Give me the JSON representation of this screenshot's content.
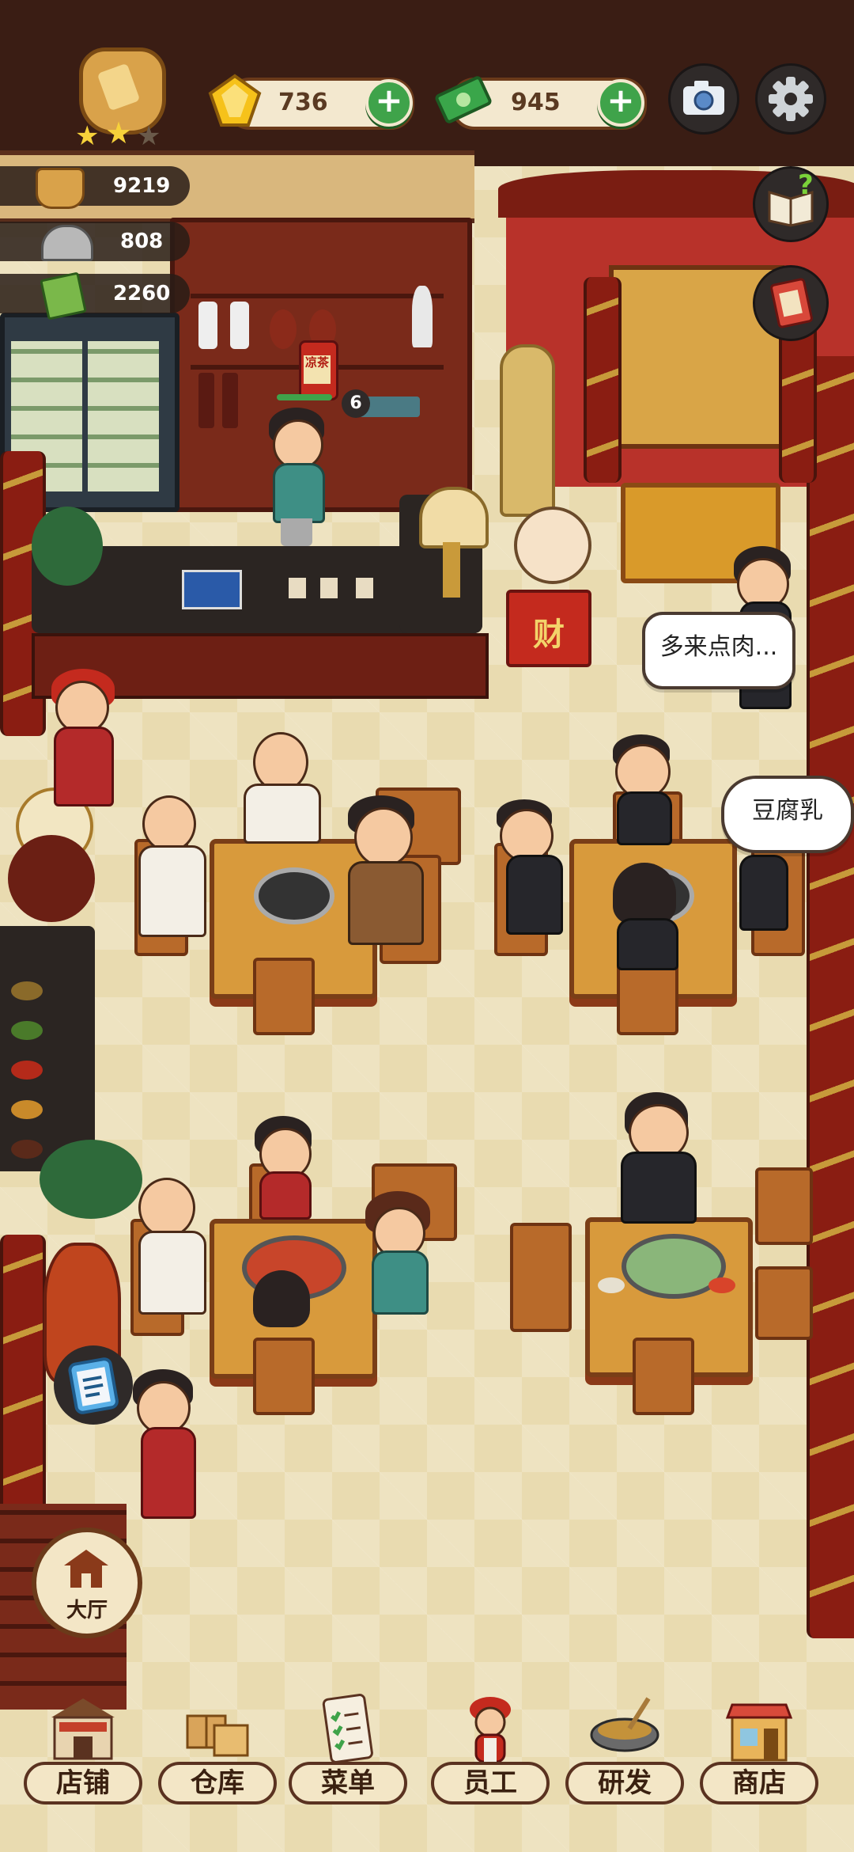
{
  "hud": {
    "currency": {
      "gems": "736",
      "cash": "945"
    },
    "stats": {
      "stat1": "9219",
      "stat2": "808",
      "stat3": "2260"
    },
    "stars_filled": 2,
    "stars_total": 3
  },
  "scene": {
    "drink_label": "凉茶",
    "drink_count": "6",
    "cat_sign": "财",
    "bubbles": {
      "b1": "多来点肉...",
      "b2": "豆腐乳"
    }
  },
  "side_button": {
    "label": "大厅"
  },
  "bottom_nav": [
    {
      "label": "店铺",
      "icon": "shop-icon"
    },
    {
      "label": "仓库",
      "icon": "warehouse-icon"
    },
    {
      "label": "菜单",
      "icon": "menu-icon"
    },
    {
      "label": "员工",
      "icon": "staff-icon"
    },
    {
      "label": "研发",
      "icon": "research-icon"
    },
    {
      "label": "商店",
      "icon": "store-icon"
    }
  ],
  "colors": {
    "plus": "#3fa34a",
    "wall": "#3a1d14",
    "floor": "#e9dbb0"
  }
}
